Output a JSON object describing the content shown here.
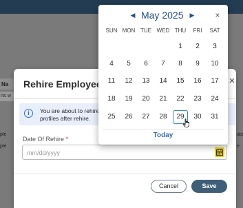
{
  "background": {
    "table_header_fragment": "Na",
    "input_fragment": "rts w",
    "row_fragments_left": [
      "ple",
      "ple"
    ],
    "row_fragments_right": [
      "abc",
      "e"
    ]
  },
  "modal": {
    "title": "Rehire Employees",
    "close_glyph": "×",
    "info_message": "You are about to rehire profiles after rehire.",
    "date_field": {
      "label": "Date Of Rehire",
      "required_mark": "*",
      "value": "",
      "placeholder": "mm/dd/yyyy"
    },
    "cancel_label": "Cancel",
    "save_label": "Save"
  },
  "calendar": {
    "month_label": "May 2025",
    "prev_glyph": "◀",
    "next_glyph": "▶",
    "close_glyph": "×",
    "weekdays": [
      "SUN",
      "MON",
      "TUE",
      "WED",
      "THU",
      "FRI",
      "SAT"
    ],
    "weeks": [
      [
        "",
        "",
        "",
        "",
        "1",
        "2",
        "3"
      ],
      [
        "4",
        "5",
        "6",
        "7",
        "8",
        "9",
        "10"
      ],
      [
        "11",
        "12",
        "13",
        "14",
        "15",
        "16",
        "17"
      ],
      [
        "18",
        "19",
        "20",
        "21",
        "22",
        "23",
        "24"
      ],
      [
        "25",
        "26",
        "27",
        "28",
        "29",
        "30",
        "31"
      ]
    ],
    "highlighted_day": "29",
    "today_label": "Today"
  },
  "colors": {
    "topbar": "#233c52",
    "accent": "#1f4f8a",
    "calendar_button": "#f2d200",
    "save_button": "#3f5f78",
    "info_banner": "#e8eefc"
  }
}
